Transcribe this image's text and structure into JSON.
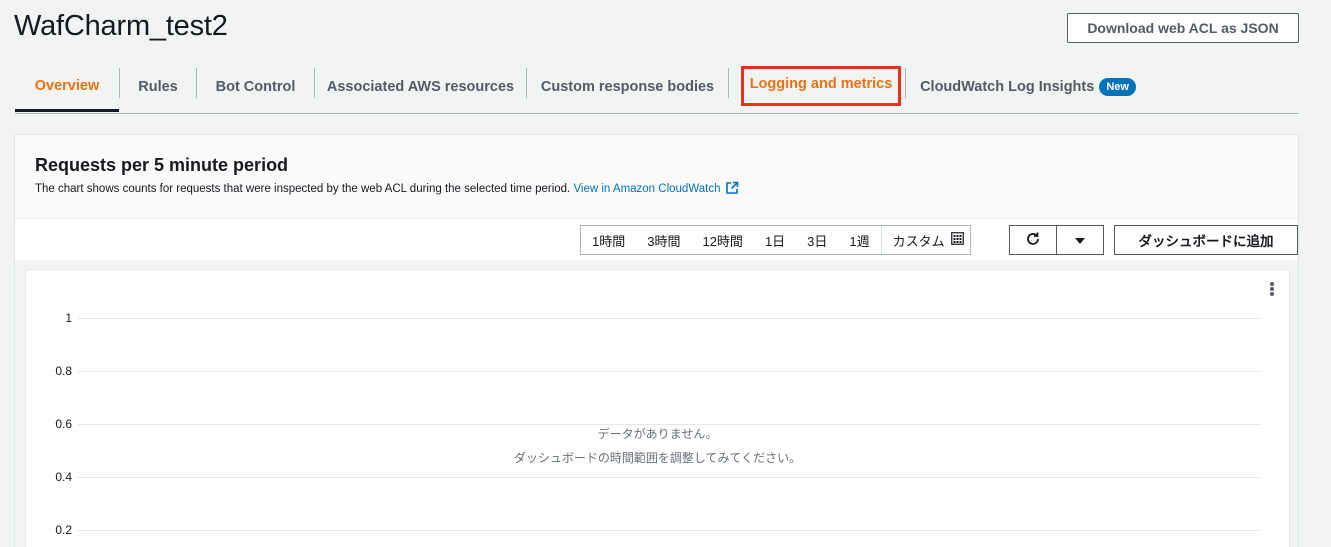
{
  "page": {
    "title": "WafCharm_test2",
    "download_button": "Download web ACL as JSON"
  },
  "tabs": [
    {
      "label": "Overview"
    },
    {
      "label": "Rules"
    },
    {
      "label": "Bot Control"
    },
    {
      "label": "Associated AWS resources"
    },
    {
      "label": "Custom response bodies"
    },
    {
      "label": "Logging and metrics"
    },
    {
      "label": "CloudWatch Log Insights",
      "badge": "New"
    }
  ],
  "active_tab": "Overview",
  "highlighted_tab": "Logging and metrics",
  "panel": {
    "title": "Requests per 5 minute period",
    "description": "The chart shows counts for requests that were inspected by the web ACL during the selected time period.",
    "link_text": "View in Amazon CloudWatch"
  },
  "time_ranges": [
    "1時間",
    "3時間",
    "12時間",
    "1日",
    "3日",
    "1週",
    "カスタム"
  ],
  "toolbar": {
    "add_to_dashboard": "ダッシュボードに追加"
  },
  "chart": {
    "y_ticks": [
      "1",
      "0.8",
      "0.6",
      "0.4",
      "0.2"
    ],
    "no_data_line1": "データがありません。",
    "no_data_line2": "ダッシュボードの時間範囲を調整してみてください。"
  },
  "chart_data": {
    "type": "line",
    "title": "",
    "xlabel": "",
    "ylabel": "",
    "ylim": [
      0,
      1
    ],
    "yticks": [
      1,
      0.8,
      0.6,
      0.4,
      0.2
    ],
    "series": [],
    "grid": true
  },
  "colors": {
    "accent": "#ec7211",
    "link": "#0073bb",
    "highlight_box": "#e8321f",
    "badge": "#0073bb"
  }
}
